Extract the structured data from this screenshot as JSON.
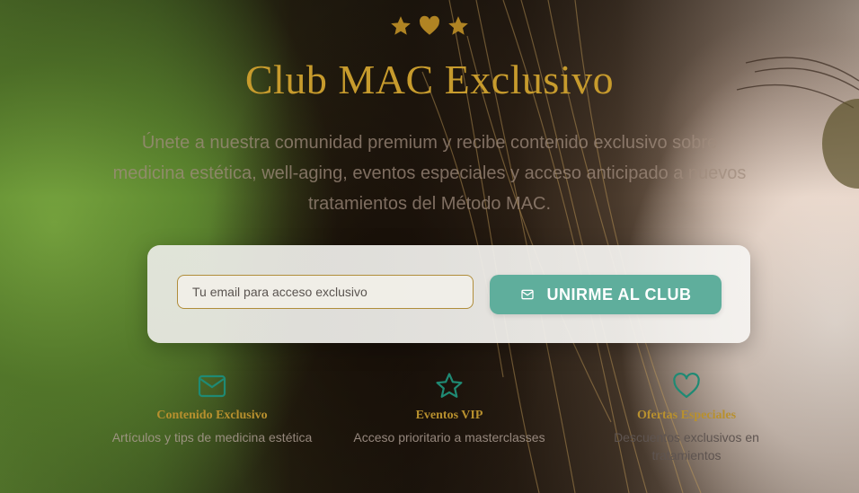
{
  "colors": {
    "gold": "#c79b2d",
    "teal": "#5fae9c",
    "icon_teal": "#1f8a74",
    "star_gold": "#b08423"
  },
  "rating_icons": [
    "star-icon",
    "heart-icon",
    "star-icon"
  ],
  "hero": {
    "title": "Club MAC Exclusivo",
    "subtitle": "Únete a nuestra comunidad premium y recibe contenido exclusivo sobre medicina estética, well-aging, eventos especiales y acceso anticipado a nuevos tratamientos del Método MAC."
  },
  "signup": {
    "email_placeholder": "Tu email para acceso exclusivo",
    "email_value": "",
    "button_icon": "mail-icon",
    "button_label": "UNIRME AL CLUB"
  },
  "features": [
    {
      "icon": "mail-icon",
      "title": "Contenido Exclusivo",
      "description": "Artículos y tips de medicina estética"
    },
    {
      "icon": "star-icon",
      "title": "Eventos VIP",
      "description": "Acceso prioritario a masterclasses"
    },
    {
      "icon": "heart-icon",
      "title": "Ofertas Especiales",
      "description": "Descuentos exclusivos en tratamientos"
    }
  ]
}
